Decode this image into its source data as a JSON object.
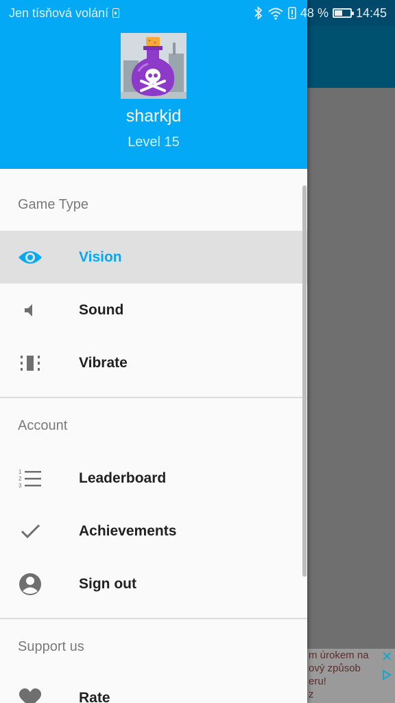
{
  "status_bar": {
    "carrier": "Jen tísňová volání",
    "battery_percent": "48 %",
    "battery_level": 0.48,
    "time": "14:45",
    "icons": [
      "sim-icon",
      "bluetooth-icon",
      "wifi-icon",
      "alert-icon",
      "battery-icon"
    ]
  },
  "profile": {
    "username": "sharkjd",
    "level": "Level 15",
    "avatar_icon": "poison-bottle-icon"
  },
  "sections": {
    "game_type": "Game Type",
    "account": "Account",
    "support": "Support us"
  },
  "items": {
    "vision": {
      "label": "Vision",
      "icon": "eye-icon",
      "selected": true
    },
    "sound": {
      "label": "Sound",
      "icon": "speaker-icon"
    },
    "vibrate": {
      "label": "Vibrate",
      "icon": "vibrate-icon"
    },
    "leaderboard": {
      "label": "Leaderboard",
      "icon": "numbered-list-icon"
    },
    "achievements": {
      "label": "Achievements",
      "icon": "check-icon"
    },
    "sign_out": {
      "label": "Sign out",
      "icon": "account-circle-icon"
    },
    "rate": {
      "label": "Rate",
      "icon": "heart-icon"
    }
  },
  "ad": {
    "text": "m úrokem na\nový způsob\neru!\nz"
  },
  "colors": {
    "accent": "#03a9f4",
    "header_bg": "#03a9f4",
    "selected_bg": "#e0e0e0",
    "icon_gray": "#757575"
  }
}
